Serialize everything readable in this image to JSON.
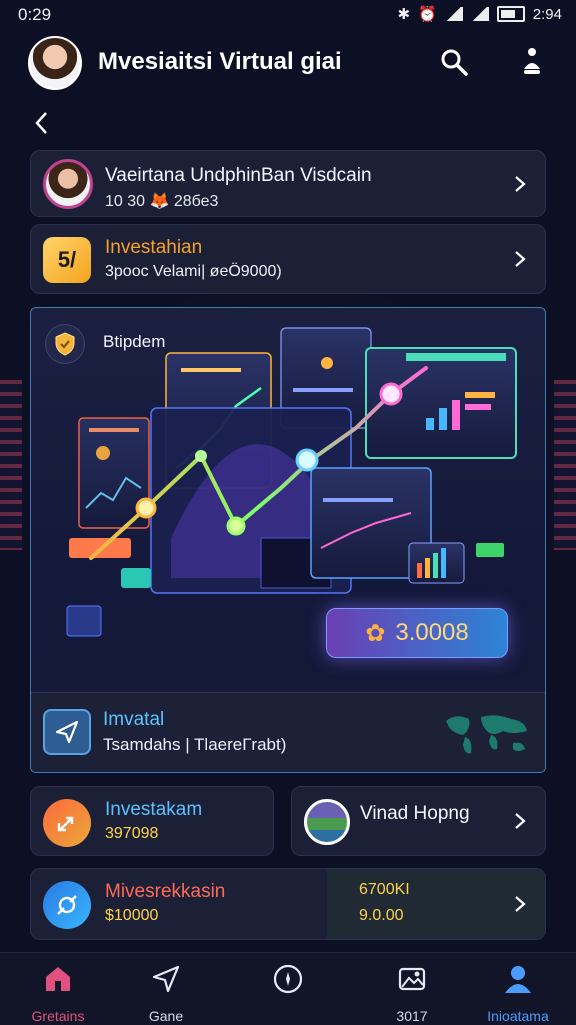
{
  "status_bar": {
    "time": "0:29",
    "clock_right": "2:94"
  },
  "header": {
    "title": "Mvesiaitsi Virtual giai"
  },
  "cards": {
    "profile": {
      "title": "Vaeirtana UndphinВаn Visdcain",
      "subtitle": "10 30  🦊 28бе3"
    },
    "investment": {
      "title": "Investahian",
      "subtitle": "3pooс Velami| øеÖ9000)"
    }
  },
  "hero": {
    "label": "Btipdem",
    "value": "3.0008",
    "footer_title": "Imvatal",
    "footer_subtitle": "Tsamdahs | TlaereГrabt)"
  },
  "split": {
    "left": {
      "title": "Investakam",
      "value": "397098"
    },
    "right": {
      "title": "Vinad Hopng"
    }
  },
  "last_row": {
    "title": "Mivesrekkasin",
    "value": "$10000",
    "right_top": "6700KI",
    "right_bottom": "9.0.00"
  },
  "nav": {
    "items": [
      {
        "label": "Gretains",
        "icon": "home-icon"
      },
      {
        "label": "Gane",
        "icon": "send-icon"
      },
      {
        "label": "",
        "icon": "compass-icon"
      },
      {
        "label": "3017",
        "icon": "gallery-icon"
      },
      {
        "label": "Inioatama",
        "icon": "person-icon"
      }
    ]
  },
  "colors": {
    "background": "#0d0f24",
    "card": "#1b2036",
    "accent_orange": "#f7a02b",
    "accent_blue": "#5cc2ff",
    "accent_pink": "#e0517f",
    "accent_yellow": "#ffd77a"
  }
}
